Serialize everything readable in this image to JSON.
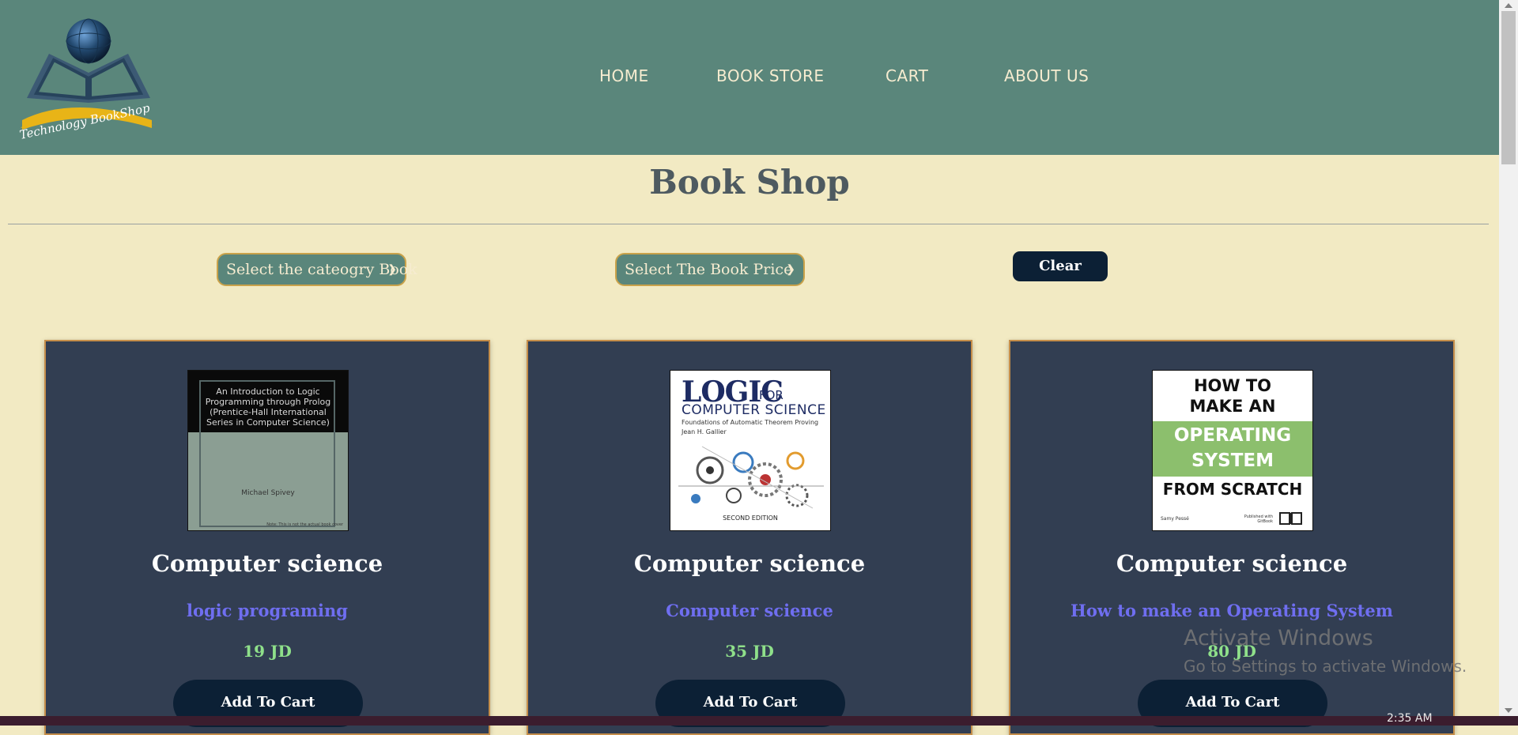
{
  "header": {
    "logo_text": "Technology BookShop",
    "nav": [
      "HOME",
      "BOOK STORE",
      "CART",
      "ABOUT US"
    ]
  },
  "page": {
    "title": "Book Shop"
  },
  "filters": {
    "category_select": "Select the cateogry Book",
    "price_select": "Select The Book Price",
    "clear_label": "Clear"
  },
  "books": [
    {
      "category": "Computer science",
      "title": "logic programing",
      "price": "19 JD",
      "add_label": "Add To Cart",
      "cover": {
        "text": "An Introduction to Logic Programming through Prolog (Prentice-Hall International Series in Computer Science)",
        "author": "Michael Spivey",
        "note": "Note: This is not the actual book cover"
      }
    },
    {
      "category": "Computer science",
      "title": "Computer science",
      "price": "35 JD",
      "add_label": "Add To Cart",
      "cover": {
        "big": "LOGIC",
        "for": "FOR",
        "line": "COMPUTER SCIENCE",
        "sub": "Foundations of Automatic Theorem Proving",
        "author": "Jean H. Gallier",
        "edition": "SECOND EDITION"
      }
    },
    {
      "category": "Computer science",
      "title": "How to make an Operating System",
      "price": "80 JD",
      "add_label": "Add To Cart",
      "cover": {
        "line1": "HOW TO",
        "line2": "MAKE AN",
        "line3": "OPERATING",
        "line4": "SYSTEM",
        "line5": "FROM SCRATCH",
        "author": "Samy Pessé",
        "publisher": "Published with GitBook"
      }
    }
  ],
  "watermark": {
    "line1": "Activate Windows",
    "line2": "Go to Settings to activate Windows."
  },
  "taskbar": {
    "clock": "2:35 AM"
  },
  "colors": {
    "header_bg": "#5a867b",
    "page_bg": "#f2eac3",
    "card_bg": "#323e52",
    "button_bg": "#0c2035",
    "title_link": "#6f6ef0",
    "price": "#8fe08a"
  }
}
